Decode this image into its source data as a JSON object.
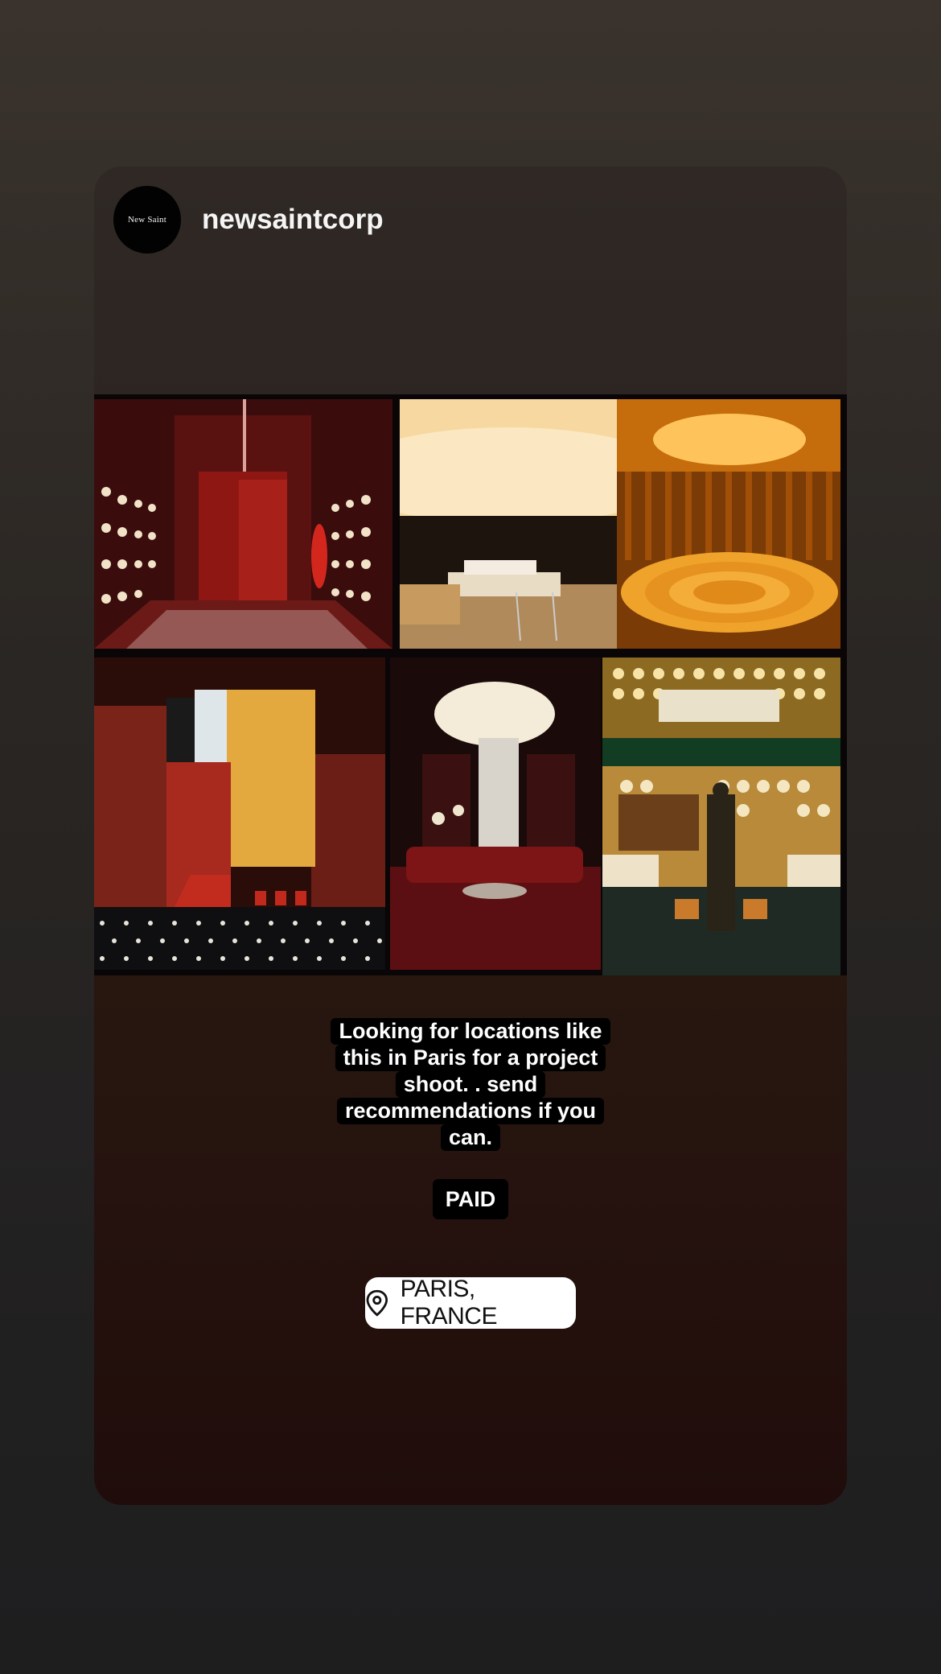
{
  "post": {
    "avatar_text": "New Saint",
    "username": "newsaintcorp"
  },
  "caption": {
    "lines": [
      "Looking for locations like",
      "this in Paris for a project",
      "shoot. . send",
      "recommendations if you",
      "can."
    ],
    "tag": "PAID"
  },
  "location": {
    "icon": "location-pin-icon",
    "label": "PARIS, FRANCE"
  },
  "colors": {
    "card_top": "#2f2824",
    "card_bottom": "#200d0b",
    "caption_bg": "#000000",
    "location_bg": "#ffffff"
  }
}
